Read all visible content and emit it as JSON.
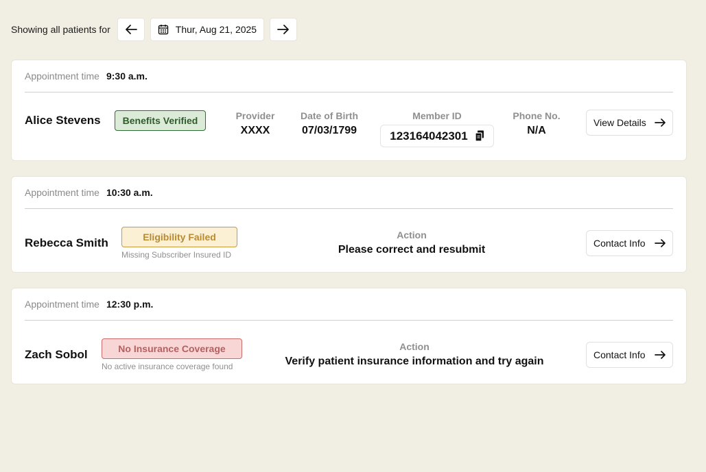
{
  "header": {
    "showing_label": "Showing all patients for",
    "date": "Thur, Aug 21, 2025",
    "icons": {
      "prev": "arrow-left-icon",
      "next": "arrow-right-icon",
      "calendar": "calendar-icon"
    }
  },
  "appointments": [
    {
      "appt_label": "Appointment time",
      "time": "9:30 a.m.",
      "patient": "Alice Stevens",
      "status": "Benefits Verified",
      "fields": {
        "provider_label": "Provider",
        "provider": "XXXX",
        "dob_label": "Date of Birth",
        "dob": "07/03/1799",
        "member_label": "Member ID",
        "member_id": "123164042301",
        "phone_label": "Phone No.",
        "phone": "N/A"
      },
      "button": "View Details"
    },
    {
      "appt_label": "Appointment time",
      "time": "10:30 a.m.",
      "patient": "Rebecca Smith",
      "status": "Eligibility Failed",
      "status_detail": "Missing Subscriber Insured ID",
      "action_label": "Action",
      "action": "Please correct and resubmit",
      "button": "Contact Info"
    },
    {
      "appt_label": "Appointment time",
      "time": "12:30 p.m.",
      "patient": "Zach Sobol",
      "status": "No Insurance Coverage",
      "status_detail": "No active insurance coverage found",
      "action_label": "Action",
      "action": "Verify patient insurance information and try again",
      "button": "Contact Info"
    }
  ],
  "colors": {
    "page_bg": "#f1eee3",
    "verified_bg": "#dcebd8",
    "verified_border": "#2f6b36",
    "verified_text": "#2f5a2c",
    "failed_bg": "#fbefd4",
    "failed_border": "#c99a3e",
    "failed_text": "#b88a32",
    "no_coverage_bg": "#f9d6d6",
    "no_coverage_border": "#c76b6b",
    "no_coverage_text": "#b5605f"
  }
}
